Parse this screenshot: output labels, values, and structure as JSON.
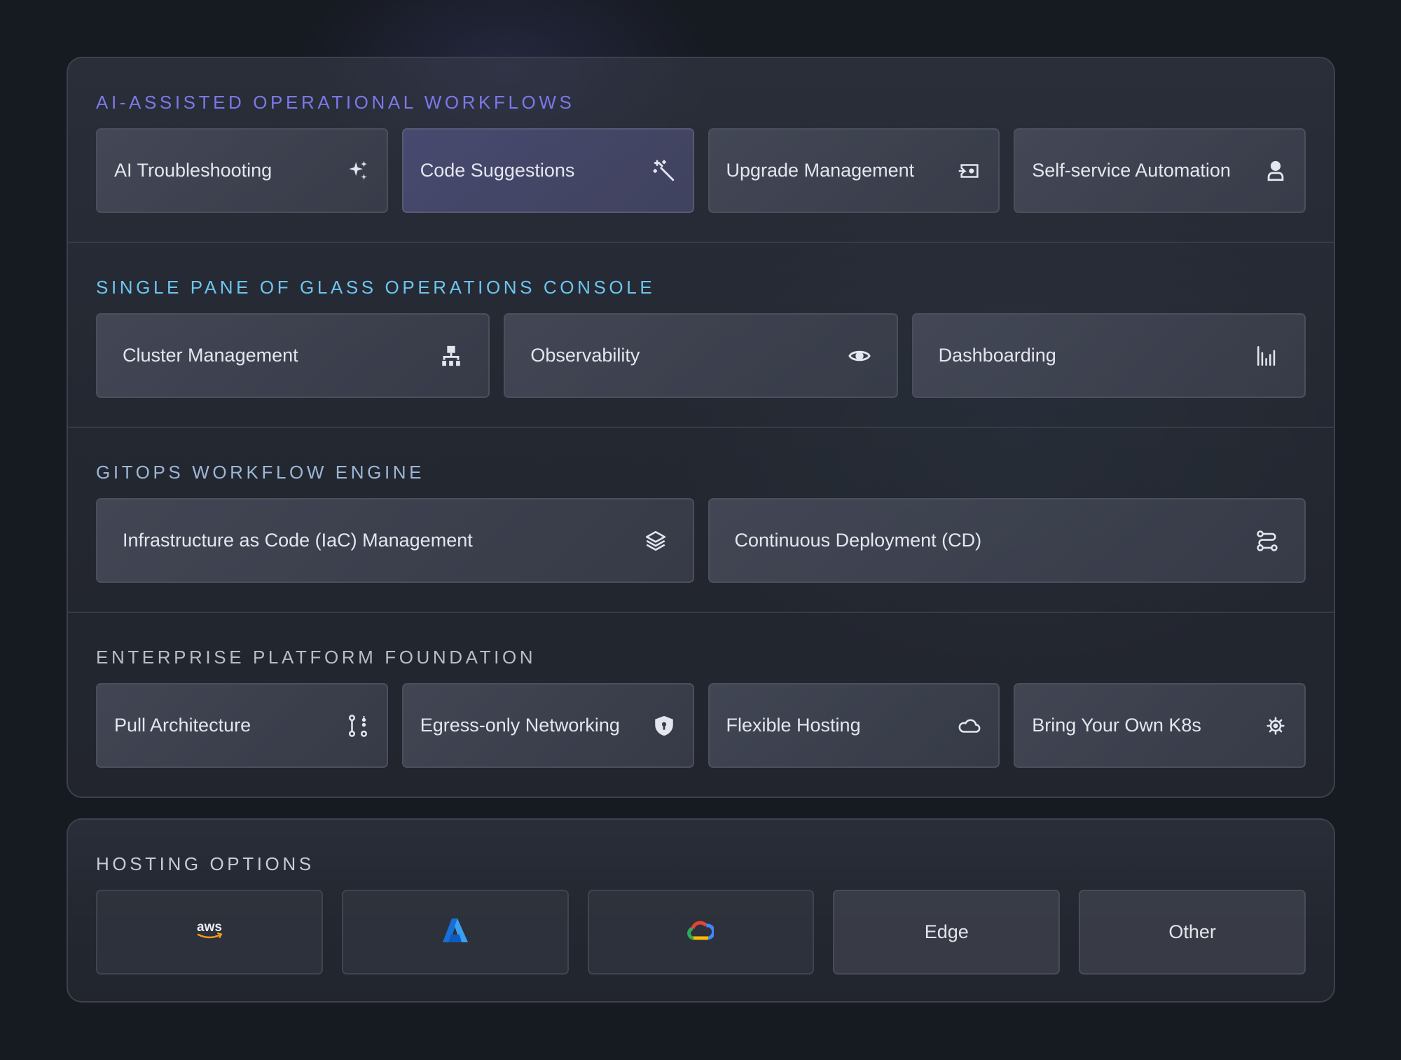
{
  "colors": {
    "ai_title": "#7d78e8",
    "glass_title": "#6cc6f0",
    "gitops_title": "#9db6d6",
    "foundation_title": "#b9bdc6",
    "hosting_title": "#c9ccd3"
  },
  "sections": [
    {
      "title": "AI-ASSISTED OPERATIONAL WORKFLOWS",
      "cards": [
        {
          "label": "AI Troubleshooting",
          "icon": "sparkles-icon"
        },
        {
          "label": "Code Suggestions",
          "icon": "magic-wand-icon"
        },
        {
          "label": "Upgrade Management",
          "icon": "upgrade-icon"
        },
        {
          "label": "Self-service Automation",
          "icon": "user-icon"
        }
      ]
    },
    {
      "title": "SINGLE PANE OF GLASS OPERATIONS CONSOLE",
      "cards": [
        {
          "label": "Cluster Management",
          "icon": "cluster-icon"
        },
        {
          "label": "Observability",
          "icon": "eye-icon"
        },
        {
          "label": "Dashboarding",
          "icon": "bar-chart-icon"
        }
      ]
    },
    {
      "title": "GITOPS WORKFLOW ENGINE",
      "cards": [
        {
          "label": "Infrastructure as Code (IaC) Management",
          "icon": "layers-icon"
        },
        {
          "label": "Continuous Deployment (CD)",
          "icon": "route-icon"
        }
      ]
    },
    {
      "title": "ENTERPRISE PLATFORM FOUNDATION",
      "cards": [
        {
          "label": "Pull Architecture",
          "icon": "git-pull-icon"
        },
        {
          "label": "Egress-only Networking",
          "icon": "shield-icon"
        },
        {
          "label": "Flexible Hosting",
          "icon": "cloud-icon"
        },
        {
          "label": "Bring Your Own K8s",
          "icon": "helm-wheel-icon"
        }
      ]
    }
  ],
  "hosting": {
    "title": "HOSTING OPTIONS",
    "options": [
      {
        "logo": "aws-logo",
        "logo_text": "aws"
      },
      {
        "logo": "azure-logo"
      },
      {
        "logo": "google-cloud-logo"
      },
      {
        "label": "Edge"
      },
      {
        "label": "Other"
      }
    ]
  }
}
